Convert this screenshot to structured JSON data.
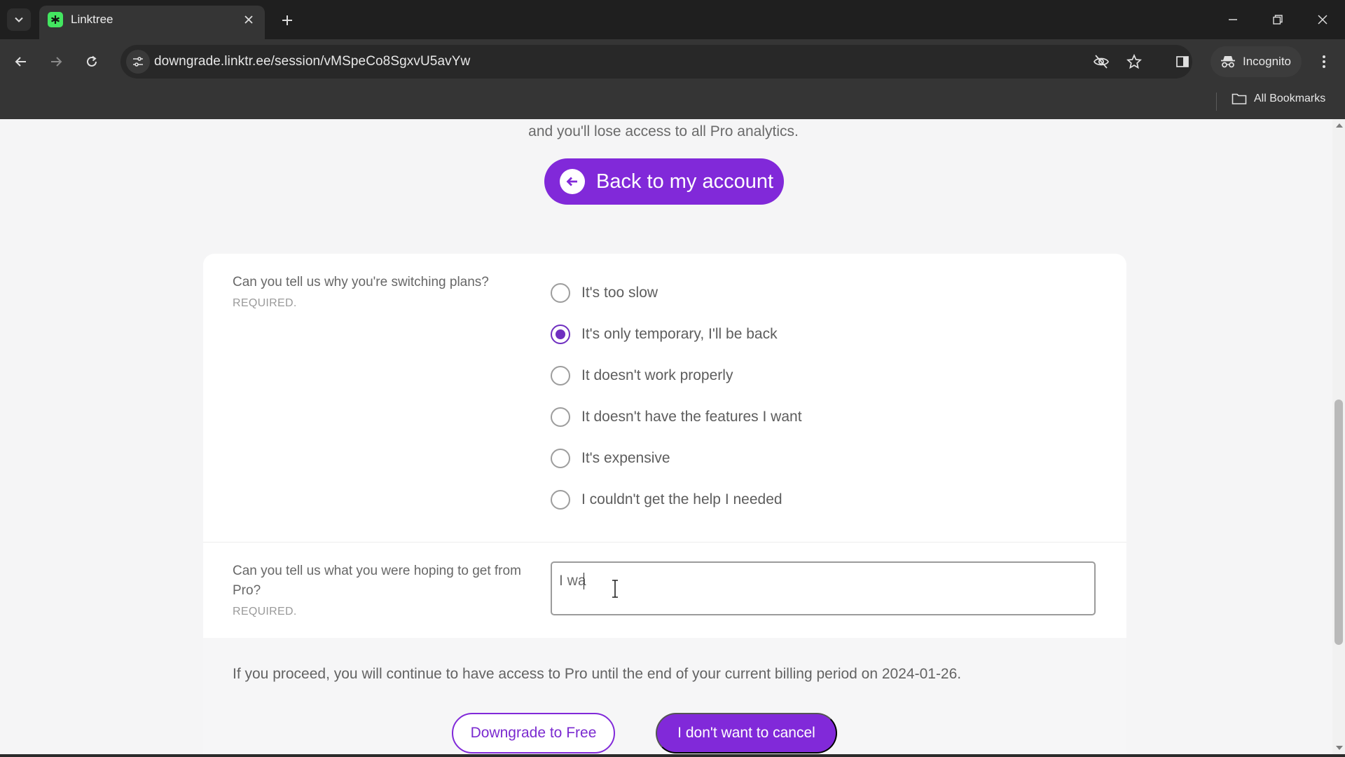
{
  "browser": {
    "tab_title": "Linktree",
    "url": "downgrade.linktr.ee/session/vMSpeCo8SgxvU5avYw",
    "incognito_label": "Incognito",
    "bookmarks_label": "All Bookmarks",
    "favicon_color": "#43e660"
  },
  "page": {
    "intro_text": "and you'll lose access to all Pro analytics.",
    "back_button_label": "Back to my account",
    "accent_color": "#8129d9",
    "question1": {
      "label": "Can you tell us why you're switching plans?",
      "required": "REQUIRED.",
      "options": [
        {
          "label": "It's too slow",
          "selected": false
        },
        {
          "label": "It's only temporary, I'll be back",
          "selected": true
        },
        {
          "label": "It doesn't work properly",
          "selected": false
        },
        {
          "label": "It doesn't have the features I want",
          "selected": false
        },
        {
          "label": "It's expensive",
          "selected": false
        },
        {
          "label": "I couldn't get the help I needed",
          "selected": false
        }
      ]
    },
    "question2": {
      "label": "Can you tell us what you were hoping to get from Pro?",
      "required": "REQUIRED.",
      "value": "I wa"
    },
    "footer_note": "If you proceed, you will continue to have access to Pro until the end of your current billing period on 2024-01-26.",
    "downgrade_button_label": "Downgrade to Free",
    "keep_button_label": "I don't want to cancel"
  }
}
